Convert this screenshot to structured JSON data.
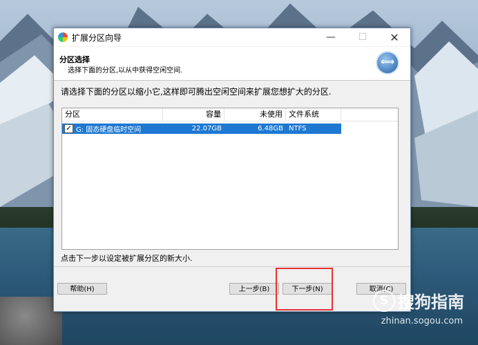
{
  "window": {
    "title": "扩展分区向导",
    "minimize": "—",
    "maximize": "☐",
    "close": "✕"
  },
  "header": {
    "title": "分区选择",
    "subtitle": "选择下面的分区,以从中获得空闲空间.",
    "icon": "resize-arrows-icon"
  },
  "instruction": "请选择下面的分区以缩小它,这样即可腾出空闲空间来扩展您想扩大的分区.",
  "table": {
    "columns": [
      "分区",
      "容量",
      "未使用",
      "文件系统"
    ],
    "rows": [
      {
        "checked": "✓",
        "partition": "G: 固态硬盘临时空间",
        "capacity": "22.07GB",
        "unused": "6.48GB",
        "fs": "NTFS"
      }
    ]
  },
  "hint": "点击下一步以设定被扩展分区的新大小.",
  "buttons": {
    "help": "帮助(H)",
    "prev": "上一步(B)",
    "next": "下一步(N)",
    "cancel": "取消(C)"
  },
  "watermark": {
    "logo": "S",
    "text": "搜狗指南",
    "url": "zhinan.sogou.com"
  },
  "colors": {
    "selection": "#1e78d2",
    "highlight_box": "#e53030"
  }
}
